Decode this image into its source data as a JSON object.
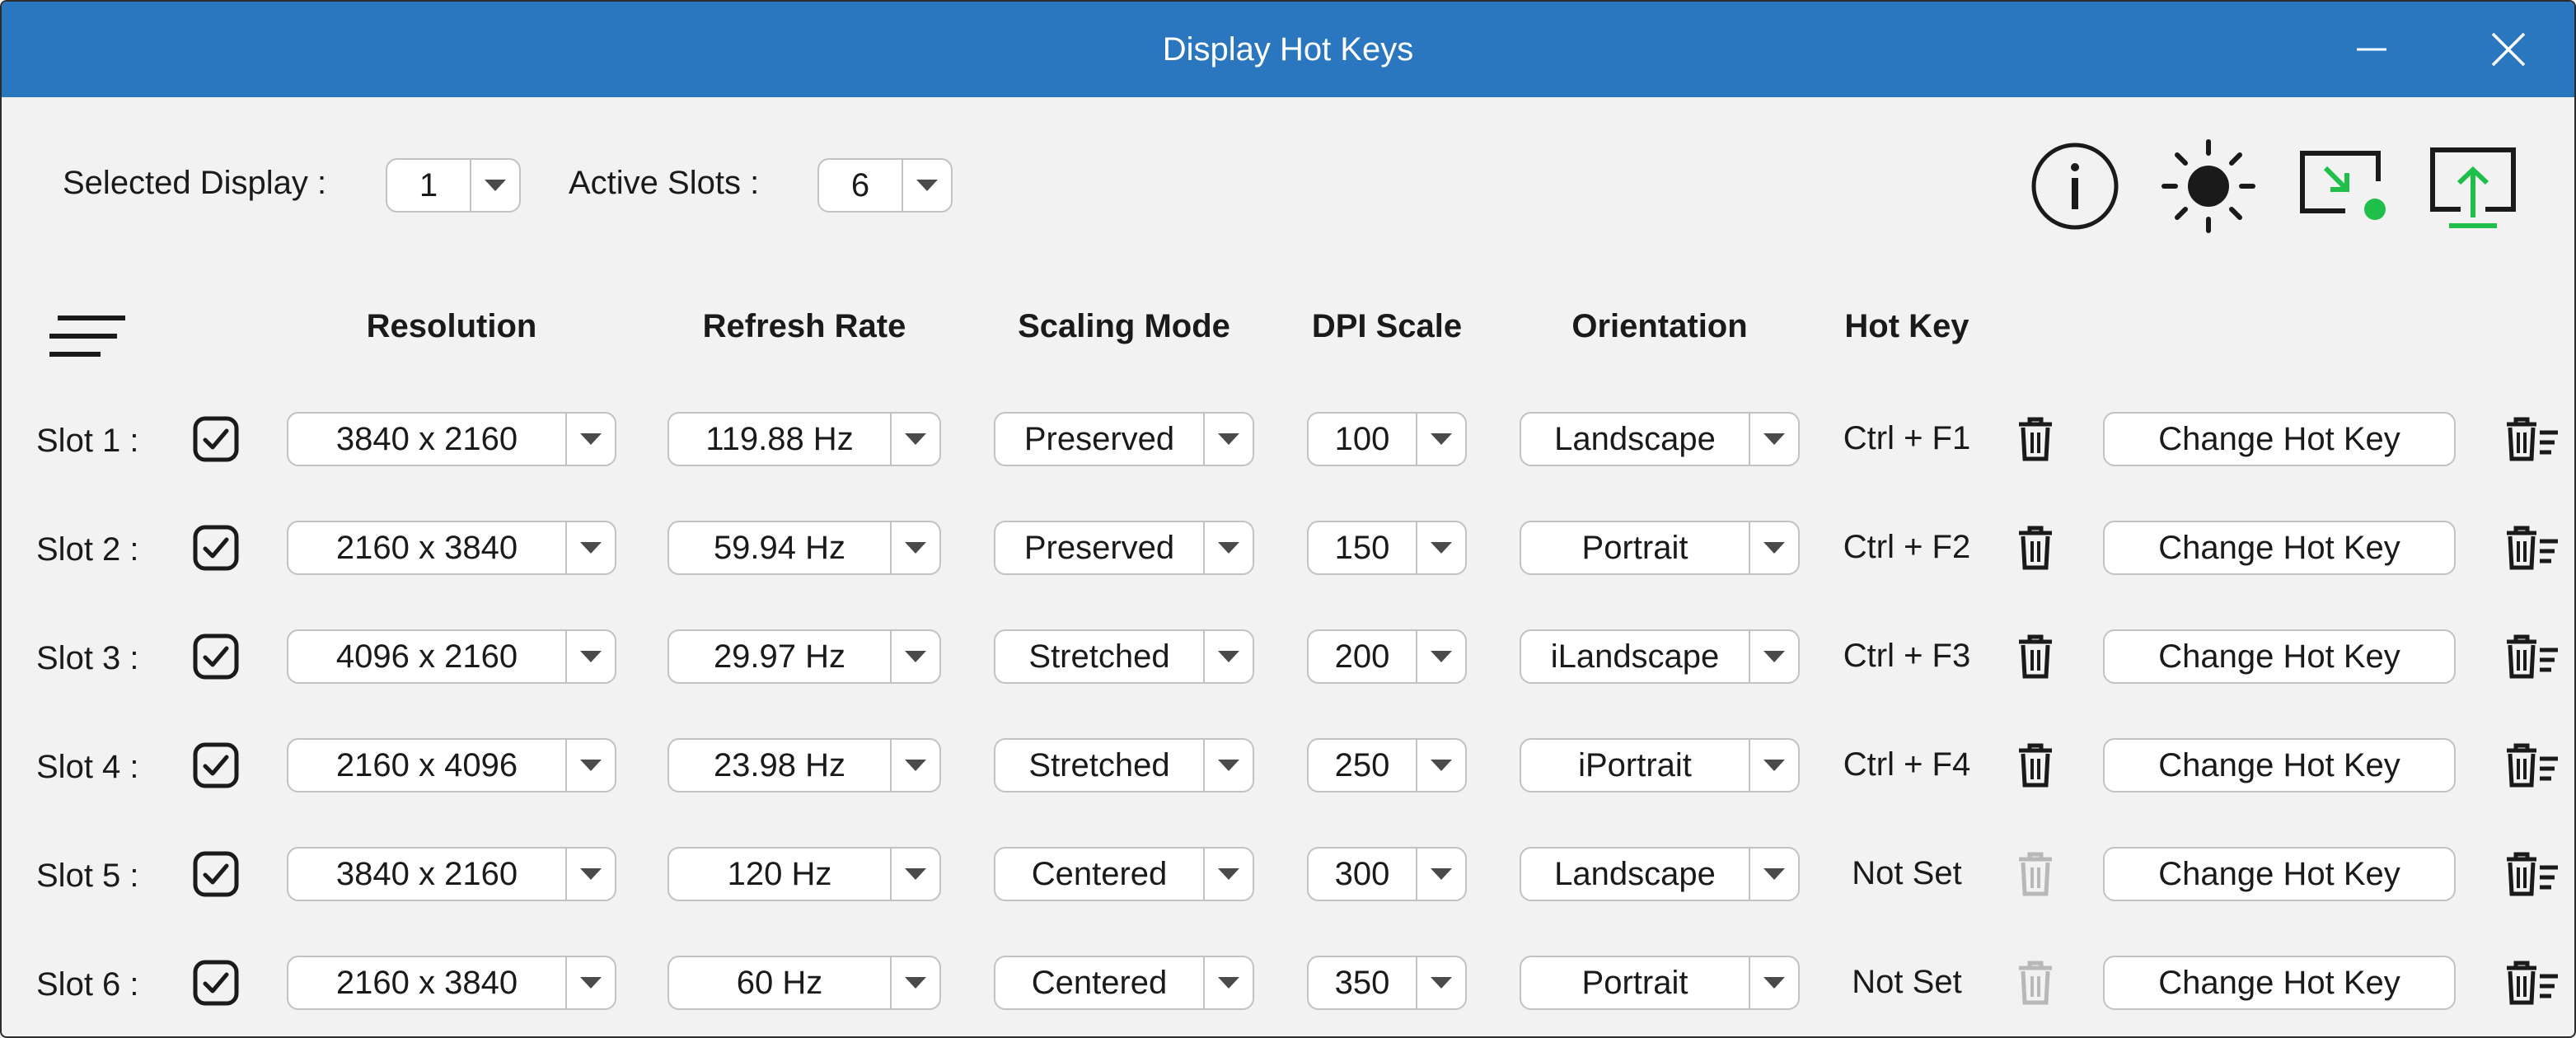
{
  "window": {
    "title": "Display Hot Keys"
  },
  "toolbar": {
    "selected_display_label": "Selected Display :",
    "selected_display_value": "1",
    "active_slots_label": "Active Slots :",
    "active_slots_value": "6",
    "icons": [
      "info-icon",
      "brightness-icon",
      "display-apply-icon",
      "display-export-icon"
    ],
    "accent_green": "#1fbf4a"
  },
  "columns": {
    "resolution": "Resolution",
    "refresh_rate": "Refresh Rate",
    "scaling_mode": "Scaling Mode",
    "dpi_scale": "DPI Scale",
    "orientation": "Orientation",
    "hot_key": "Hot Key"
  },
  "slots": [
    {
      "label": "Slot 1 :",
      "checked": true,
      "resolution": "3840 x 2160",
      "refresh_rate": "119.88 Hz",
      "scaling_mode": "Preserved",
      "dpi_scale": "100",
      "orientation": "Landscape",
      "hot_key": "Ctrl + F1",
      "hot_key_set": true,
      "button": "Change Hot Key"
    },
    {
      "label": "Slot 2 :",
      "checked": true,
      "resolution": "2160 x 3840",
      "refresh_rate": "59.94 Hz",
      "scaling_mode": "Preserved",
      "dpi_scale": "150",
      "orientation": "Portrait",
      "hot_key": "Ctrl + F2",
      "hot_key_set": true,
      "button": "Change Hot Key"
    },
    {
      "label": "Slot 3 :",
      "checked": true,
      "resolution": "4096 x 2160",
      "refresh_rate": "29.97 Hz",
      "scaling_mode": "Stretched",
      "dpi_scale": "200",
      "orientation": "iLandscape",
      "hot_key": "Ctrl + F3",
      "hot_key_set": true,
      "button": "Change Hot Key"
    },
    {
      "label": "Slot 4 :",
      "checked": true,
      "resolution": "2160 x 4096",
      "refresh_rate": "23.98 Hz",
      "scaling_mode": "Stretched",
      "dpi_scale": "250",
      "orientation": "iPortrait",
      "hot_key": "Ctrl + F4",
      "hot_key_set": true,
      "button": "Change Hot Key"
    },
    {
      "label": "Slot 5 :",
      "checked": true,
      "resolution": "3840 x 2160",
      "refresh_rate": "120 Hz",
      "scaling_mode": "Centered",
      "dpi_scale": "300",
      "orientation": "Landscape",
      "hot_key": "Not Set",
      "hot_key_set": false,
      "button": "Change Hot Key"
    },
    {
      "label": "Slot 6 :",
      "checked": true,
      "resolution": "2160 x 3840",
      "refresh_rate": "60 Hz",
      "scaling_mode": "Centered",
      "dpi_scale": "350",
      "orientation": "Portrait",
      "hot_key": "Not Set",
      "hot_key_set": false,
      "button": "Change Hot Key"
    }
  ]
}
